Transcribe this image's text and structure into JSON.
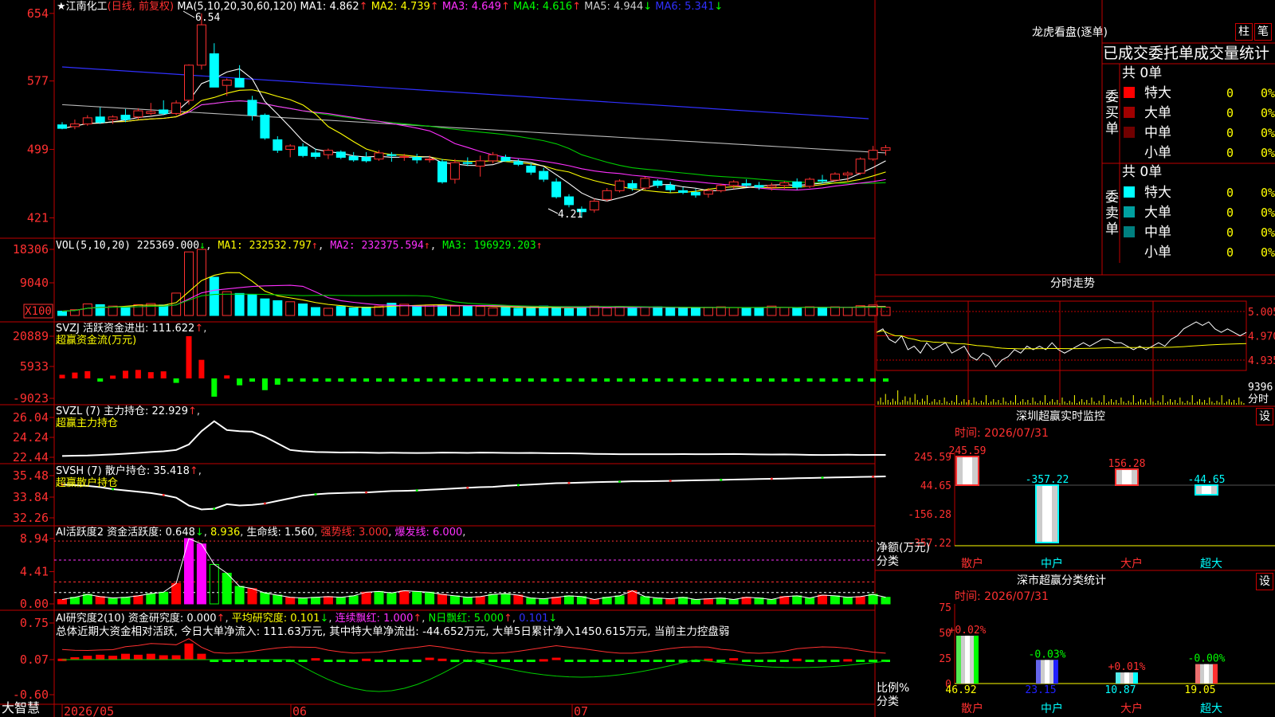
{
  "stock": {
    "star": "★",
    "name": "江南化工",
    "mode": "(日线, 前复权)"
  },
  "bottom_logo": "大智慧",
  "main_chart": {
    "ma_header": "MA(5,10,20,30,60,120)",
    "ma_items": [
      {
        "label": "MA1: 4.862",
        "arrow": "↑",
        "color": "#ffffff"
      },
      {
        "label": "MA2: 4.739",
        "arrow": "↑",
        "color": "#ffff00"
      },
      {
        "label": "MA3: 4.649",
        "arrow": "↑",
        "color": "#ff30ff"
      },
      {
        "label": "MA4: 4.616",
        "arrow": "↑",
        "color": "#00ff00"
      },
      {
        "label": "MA5: 4.944",
        "arrow": "↓",
        "color": "#cccccc"
      },
      {
        "label": "MA6: 5.341",
        "arrow": "↓",
        "color": "#3030ff"
      }
    ],
    "y_ticks": [
      "654",
      "577",
      "499",
      "421"
    ],
    "y_range": [
      4.06,
      6.62
    ],
    "high_label": "6.54",
    "low_label": "4.21"
  },
  "volume": {
    "header": "VOL(5,10,20)",
    "value": "225369.000",
    "value_arrow": "↓",
    "ma1": "MA1: 232532.797",
    "ma2": "MA2: 232375.594",
    "ma3": "MA3: 196929.203",
    "arrow_up": "↑",
    "y_ticks": [
      "18306",
      "9040"
    ],
    "unit": "X100"
  },
  "svzj": {
    "name": "SVZJ",
    "label": "活跃资金进出: 111.622",
    "arrow": "↑",
    "title": "超赢资金流(万元)",
    "y_ticks": [
      "20889",
      "5933",
      "-9023"
    ]
  },
  "svzl": {
    "header": "SVZL (7) 主力持仓: 22.929",
    "arrow": "↑",
    "title": "超赢主力持仓",
    "y_ticks": [
      "26.04",
      "24.24",
      "22.44"
    ]
  },
  "svsh": {
    "header": "SVSH (7) 散户持仓: 35.418",
    "arrow": "↑",
    "title": "超赢散户持仓",
    "y_ticks": [
      "35.48",
      "33.84",
      "32.26"
    ]
  },
  "ai_active": {
    "header": "AI活跃度2 资金活跃度: 0.648",
    "v2": "8.936",
    "life": "生命线: 1.560",
    "strong": "强势线: 3.000",
    "burst": "爆发线: 6.000",
    "arrow_down": "↓",
    "y_ticks": [
      "8.94",
      "4.41",
      "0.00"
    ]
  },
  "ai_research": {
    "header": "AI研究度2(10) 资金研究度: 0.000",
    "avg": "平均研究度: 0.101",
    "streak": "连续飘红: 1.000",
    "nday": "N日飘红: 5.000",
    "last": "0.101",
    "arrow_up": "↑",
    "arrow_down": "↓",
    "summary": "总体近期大资金相对活跃, 今日大单净流入: 111.63万元, 其中特大单净流出: -44.652万元, 大单5日累计净入1450.615万元, 当前主力控盘弱",
    "y_ticks": [
      "0.75",
      "0.07",
      "-0.60"
    ]
  },
  "date_axis": [
    "2026/05",
    "06",
    "07"
  ],
  "dragon": {
    "title": "龙虎看盘(逐单)",
    "btn_bar": "柱",
    "btn_pen": "笔",
    "header": "已成交委托单成交量统计",
    "buy_side": "委买单",
    "sell_side": "委卖单",
    "buy_total": "共 0单",
    "sell_total": "共 0单",
    "buy_rows": [
      {
        "name": "特大",
        "count": "0",
        "pct": "0%",
        "color": "#ff0000"
      },
      {
        "name": "大单",
        "count": "0",
        "pct": "0%",
        "color": "#a00000"
      },
      {
        "name": "中单",
        "count": "0",
        "pct": "0%",
        "color": "#700000"
      },
      {
        "name": "小单",
        "count": "0",
        "pct": "0%",
        "color": "#000000"
      }
    ],
    "sell_rows": [
      {
        "name": "特大",
        "count": "0",
        "pct": "0%",
        "color": "#00ffff"
      },
      {
        "name": "大单",
        "count": "0",
        "pct": "0%",
        "color": "#00a0a0"
      },
      {
        "name": "中单",
        "count": "0",
        "pct": "0%",
        "color": "#008080"
      },
      {
        "name": "小单",
        "count": "0",
        "pct": "0%",
        "color": "#000000"
      }
    ]
  },
  "intraday": {
    "title": "分时走势",
    "y_ticks": [
      "5.005",
      "4.970",
      "4.935"
    ],
    "vol_label": "9396",
    "unit_label": "分时"
  },
  "sz_monitor": {
    "title": "深圳超赢实时监控",
    "btn": "设",
    "time": "时间: 2026/07/31",
    "y_ticks": [
      "245.59",
      "44.65",
      "-156.28",
      "-357.22"
    ],
    "ylabel": "净额(万元)",
    "xlabel": "分类"
  },
  "sz_class": {
    "title": "深市超赢分类统计",
    "btn": "设",
    "time": "时间: 2026/07/31",
    "y_ticks": [
      "75",
      "50",
      "25",
      "0"
    ],
    "ylabel": "比例%",
    "xlabel": "分类"
  },
  "chart_data": [
    {
      "type": "candlestick",
      "title": "江南化工 (日线, 前复权)",
      "ohlc": [
        [
          5.27,
          5.3,
          5.22,
          5.23
        ],
        [
          5.25,
          5.33,
          5.22,
          5.28
        ],
        [
          5.28,
          5.38,
          5.26,
          5.35
        ],
        [
          5.36,
          5.47,
          5.28,
          5.3
        ],
        [
          5.33,
          5.38,
          5.28,
          5.36
        ],
        [
          5.38,
          5.45,
          5.3,
          5.33
        ],
        [
          5.36,
          5.46,
          5.33,
          5.43
        ],
        [
          5.4,
          5.52,
          5.38,
          5.42
        ],
        [
          5.44,
          5.55,
          5.38,
          5.4
        ],
        [
          5.4,
          5.55,
          5.38,
          5.52
        ],
        [
          5.55,
          5.96,
          5.5,
          5.95
        ],
        [
          5.95,
          6.54,
          5.9,
          6.41
        ],
        [
          6.08,
          6.2,
          5.7,
          5.7
        ],
        [
          5.72,
          5.8,
          5.6,
          5.78
        ],
        [
          5.8,
          5.95,
          5.7,
          5.7
        ],
        [
          5.55,
          5.6,
          5.32,
          5.38
        ],
        [
          5.38,
          5.4,
          5.1,
          5.12
        ],
        [
          5.1,
          5.14,
          4.95,
          4.98
        ],
        [
          4.99,
          5.05,
          4.9,
          5.03
        ],
        [
          5.02,
          5.06,
          4.9,
          4.92
        ],
        [
          4.95,
          5.0,
          4.88,
          4.91
        ],
        [
          4.93,
          5.0,
          4.88,
          4.98
        ],
        [
          4.96,
          4.98,
          4.88,
          4.9
        ],
        [
          4.91,
          4.96,
          4.85,
          4.87
        ],
        [
          4.9,
          4.96,
          4.84,
          4.86
        ],
        [
          4.88,
          4.98,
          4.86,
          4.95
        ],
        [
          4.93,
          4.96,
          4.85,
          4.92
        ],
        [
          4.9,
          4.94,
          4.86,
          4.91
        ],
        [
          4.9,
          4.94,
          4.83,
          4.87
        ],
        [
          4.88,
          4.92,
          4.84,
          4.88
        ],
        [
          4.85,
          4.88,
          4.6,
          4.62
        ],
        [
          4.65,
          4.88,
          4.6,
          4.84
        ],
        [
          4.84,
          4.9,
          4.8,
          4.83
        ],
        [
          4.8,
          4.92,
          4.68,
          4.86
        ],
        [
          4.86,
          4.96,
          4.83,
          4.93
        ],
        [
          4.9,
          4.93,
          4.85,
          4.86
        ],
        [
          4.85,
          4.88,
          4.8,
          4.82
        ],
        [
          4.8,
          4.83,
          4.7,
          4.73
        ],
        [
          4.74,
          4.78,
          4.62,
          4.65
        ],
        [
          4.62,
          4.66,
          4.43,
          4.45
        ],
        [
          4.45,
          4.48,
          4.33,
          4.36
        ],
        [
          4.31,
          4.34,
          4.21,
          4.28
        ],
        [
          4.3,
          4.43,
          4.27,
          4.4
        ],
        [
          4.42,
          4.55,
          4.4,
          4.52
        ],
        [
          4.52,
          4.65,
          4.5,
          4.63
        ],
        [
          4.6,
          4.64,
          4.52,
          4.55
        ],
        [
          4.55,
          4.68,
          4.53,
          4.66
        ],
        [
          4.63,
          4.65,
          4.55,
          4.58
        ],
        [
          4.58,
          4.62,
          4.5,
          4.53
        ],
        [
          4.52,
          4.56,
          4.48,
          4.5
        ],
        [
          4.5,
          4.54,
          4.44,
          4.47
        ],
        [
          4.48,
          4.55,
          4.44,
          4.52
        ],
        [
          4.52,
          4.6,
          4.5,
          4.58
        ],
        [
          4.58,
          4.64,
          4.54,
          4.62
        ],
        [
          4.6,
          4.65,
          4.56,
          4.58
        ],
        [
          4.58,
          4.62,
          4.53,
          4.56
        ],
        [
          4.56,
          4.61,
          4.52,
          4.58
        ],
        [
          4.58,
          4.63,
          4.54,
          4.61
        ],
        [
          4.62,
          4.66,
          4.53,
          4.56
        ],
        [
          4.57,
          4.67,
          4.55,
          4.65
        ],
        [
          4.64,
          4.7,
          4.6,
          4.63
        ],
        [
          4.64,
          4.73,
          4.62,
          4.71
        ],
        [
          4.7,
          4.74,
          4.62,
          4.72
        ],
        [
          4.72,
          4.9,
          4.7,
          4.88
        ],
        [
          4.88,
          5.03,
          4.86,
          4.98
        ],
        [
          4.98,
          5.04,
          4.92,
          5.01
        ]
      ]
    },
    {
      "type": "bar",
      "title": "VOL(5,10,20)",
      "values": [
        1.2,
        1.6,
        3.2,
        3.0,
        2.6,
        2.4,
        3.0,
        3.3,
        2.9,
        6.2,
        17.6,
        18.3,
        10.6,
        6.6,
        6.1,
        5.8,
        4.6,
        4.1,
        3.8,
        3.2,
        2.2,
        2.0,
        2.5,
        2.1,
        2.3,
        2.6,
        3.4,
        3.1,
        2.6,
        2.9,
        2.8,
        2.6,
        2.6,
        2.5,
        2.1,
        2.3,
        2.0,
        2.1,
        2.6,
        2.2,
        1.9,
        2.3,
        2.6,
        2.1,
        2.5,
        2.0,
        2.3,
        2.4,
        2.1,
        2.0,
        2.1,
        2.3,
        2.4,
        2.2,
        2.0,
        2.2,
        2.6,
        2.2,
        2.0,
        2.4,
        2.3,
        2.4,
        2.2,
        2.7,
        2.9,
        2.3
      ]
    },
    {
      "type": "bar",
      "title": "超赢资金流(万元)",
      "values": [
        1800,
        2900,
        3600,
        -1200,
        1400,
        3800,
        4200,
        3100,
        3500,
        -2200,
        20889,
        9200,
        -9023,
        1500,
        -3400,
        -1600,
        -5800,
        -3100,
        -1200,
        -800,
        -900,
        -1000,
        -900,
        -1100,
        -1200,
        -1000,
        -1300,
        -1100,
        -1000,
        -1200,
        -1300,
        -1200,
        -1000,
        -1100,
        -900,
        -1200,
        -1000,
        -1200,
        -1100,
        -900,
        -1000,
        -1100,
        -1200,
        -1000,
        -1100,
        -1200,
        -1000,
        -900,
        -1100,
        -1000,
        -900,
        -1200,
        -1000,
        -1100,
        -900,
        -1000,
        -1100,
        -1000,
        -900,
        -1000,
        -1100,
        -1000,
        -1200,
        -900,
        -1000,
        -1100
      ]
    },
    {
      "type": "line",
      "title": "超赢主力持仓",
      "values": [
        22.56,
        22.58,
        22.6,
        22.65,
        22.7,
        22.76,
        22.84,
        22.92,
        22.98,
        23.1,
        23.6,
        24.8,
        25.7,
        24.9,
        24.8,
        24.75,
        24.3,
        23.7,
        23.1,
        22.98,
        22.92,
        22.9,
        22.87,
        22.88,
        22.86,
        22.84,
        22.85,
        22.84,
        22.83,
        22.84,
        22.86,
        22.85,
        22.84,
        22.86,
        22.85,
        22.84,
        22.83,
        22.84,
        22.82,
        22.8,
        22.8,
        22.78,
        22.75,
        22.74,
        22.72,
        22.72,
        22.72,
        22.72,
        22.72,
        22.73,
        22.72,
        22.72,
        22.73,
        22.74,
        22.72,
        22.7,
        22.69,
        22.7,
        22.68,
        22.66,
        22.65,
        22.66,
        22.67,
        22.65,
        22.66,
        22.66
      ]
    },
    {
      "type": "line",
      "title": "超赢散户持仓",
      "values": [
        34.8,
        34.75,
        34.7,
        34.6,
        34.45,
        34.35,
        34.25,
        34.15,
        34.0,
        33.8,
        33.2,
        32.9,
        32.95,
        33.3,
        33.2,
        33.25,
        33.35,
        33.55,
        33.75,
        33.95,
        34.05,
        34.12,
        34.15,
        34.18,
        34.2,
        34.25,
        34.3,
        34.32,
        34.35,
        34.4,
        34.45,
        34.5,
        34.55,
        34.6,
        34.62,
        34.7,
        34.75,
        34.8,
        34.85,
        34.9,
        34.92,
        34.95,
        34.98,
        35.0,
        35.02,
        35.05,
        35.05,
        35.06,
        35.08,
        35.1,
        35.12,
        35.14,
        35.15,
        35.18,
        35.2,
        35.22,
        35.24,
        35.25,
        35.28,
        35.3,
        35.32,
        35.34,
        35.36,
        35.38,
        35.4,
        35.42
      ]
    },
    {
      "type": "bar",
      "title": "AI活跃度2",
      "values": [
        0.6,
        0.9,
        1.3,
        1.0,
        0.8,
        0.9,
        1.1,
        1.4,
        1.6,
        2.8,
        8.94,
        8.2,
        5.4,
        4.2,
        2.4,
        2.1,
        1.5,
        1.2,
        0.9,
        0.8,
        0.9,
        1.0,
        0.9,
        1.1,
        1.6,
        1.7,
        1.5,
        1.8,
        1.7,
        1.6,
        1.3,
        1.1,
        0.9,
        1.0,
        1.3,
        1.4,
        1.2,
        0.8,
        0.7,
        0.9,
        1.1,
        1.0,
        0.6,
        0.9,
        1.1,
        1.8,
        1.0,
        0.8,
        0.7,
        0.9,
        0.6,
        0.7,
        0.8,
        0.6,
        0.9,
        0.8,
        0.6,
        1.0,
        1.1,
        0.8,
        1.2,
        1.1,
        0.9,
        1.0,
        1.3,
        0.9
      ],
      "lines": {
        "生命线": 1.56,
        "强势线": 3.0,
        "爆发线": 6.0
      }
    },
    {
      "type": "bar",
      "title": "AI研究度2(10)",
      "values": [
        0.02,
        0.05,
        0.08,
        0.1,
        0.08,
        0.12,
        0.1,
        0.12,
        0.09,
        0.09,
        0.33,
        0.12,
        -0.02,
        -0.01,
        -0.03,
        -0.02,
        -0.02,
        -0.02,
        -0.02,
        -0.01,
        0.03,
        -0.02,
        -0.02,
        -0.01,
        0.02,
        -0.03,
        -0.02,
        -0.03,
        -0.01,
        0.04,
        0.02,
        -0.05,
        -0.04,
        -0.05,
        -0.03,
        -0.01,
        -0.03,
        -0.02,
        0.01,
        0.04,
        -0.01,
        -0.02,
        -0.04,
        -0.05,
        -0.03,
        -0.01,
        -0.02,
        -0.03,
        -0.04,
        -0.06,
        -0.05,
        0.02,
        -0.01,
        0.03,
        -0.03,
        -0.02,
        -0.04,
        -0.01,
        0.02,
        -0.03,
        -0.02,
        -0.03,
        0.01,
        -0.02,
        -0.01,
        -0.02
      ],
      "lines": {
        "平均研究度": 0.101
      },
      "ylim": [
        -0.6,
        0.75
      ]
    },
    {
      "type": "line",
      "title": "分时走势",
      "ylim": [
        4.92,
        5.02
      ],
      "values": [
        4.975,
        4.98,
        4.965,
        4.96,
        4.97,
        4.95,
        4.955,
        4.945,
        4.96,
        4.95,
        4.955,
        4.96,
        4.945,
        4.95,
        4.955,
        4.94,
        4.935,
        4.945,
        4.94,
        4.925,
        4.935,
        4.94,
        4.95,
        4.945,
        4.955,
        4.95,
        4.955,
        4.95,
        4.96,
        4.95,
        4.945,
        4.95,
        4.955,
        4.96,
        4.955,
        4.96,
        4.965,
        4.965,
        4.96,
        4.96,
        4.955,
        4.95,
        4.955,
        4.95,
        4.955,
        4.96,
        4.955,
        4.965,
        4.97,
        4.98,
        4.985,
        4.99,
        4.985,
        4.99,
        4.98,
        4.975,
        4.98,
        4.975,
        4.97,
        4.975
      ]
    },
    {
      "type": "bar",
      "title": "深圳超赢实时监控",
      "categories": [
        "散户",
        "中户",
        "大户",
        "超大"
      ],
      "values": [
        245.59,
        -357.22,
        156.28,
        -44.65
      ],
      "labels": [
        "245.59",
        "-357.22",
        "156.28",
        "-44.65"
      ],
      "ylim": [
        -357.22,
        245.59
      ]
    },
    {
      "type": "bar",
      "title": "深市超赢分类统计",
      "categories": [
        "散户",
        "中户",
        "大户",
        "超大"
      ],
      "values": [
        46.92,
        23.15,
        10.87,
        19.05
      ],
      "changes": [
        "+0.02%",
        "-0.03%",
        "+0.01%",
        "-0.00%"
      ],
      "ylim": [
        0,
        75
      ]
    }
  ],
  "colors": {
    "up": "#ff3030",
    "down": "#00ffff",
    "grid": "#c00000"
  }
}
